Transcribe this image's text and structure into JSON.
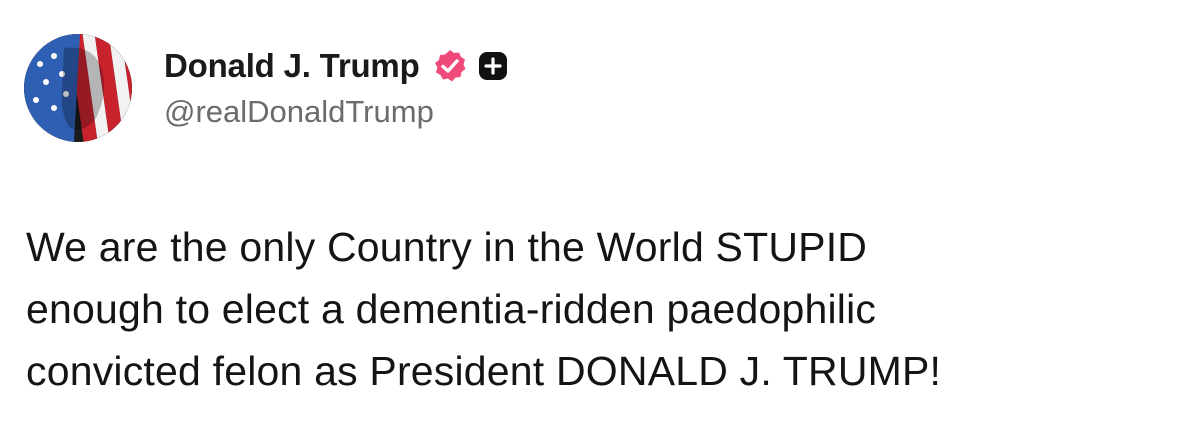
{
  "post": {
    "author": {
      "display_name": "Donald J. Trump",
      "handle": "@realDonaldTrump",
      "verified_badge_color": "#f04a7b",
      "avatar_icon": "avatar-image"
    },
    "body_lines": [
      "We are the only Country in the World STUPID",
      "enough to elect a dementia-ridden paedophilic",
      "convicted felon as President DONALD J. TRUMP!"
    ]
  },
  "colors": {
    "background": "#ffffff",
    "text": "#141414",
    "handle": "#6b6b6b",
    "verified": "#f04a7b",
    "plus_badge": "#111111"
  }
}
